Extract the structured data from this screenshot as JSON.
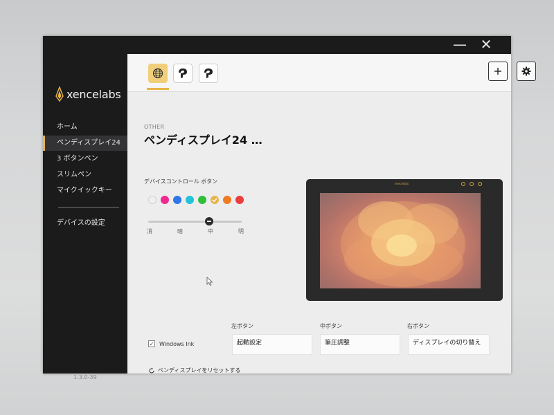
{
  "window": {
    "minimize_glyph": "—",
    "close_glyph": "✕"
  },
  "sidebar": {
    "logo_text": "xencelabs",
    "items": [
      {
        "label": "ホーム"
      },
      {
        "label": "ペンディスプレイ24",
        "active": true
      },
      {
        "label": "3 ボタンペン"
      },
      {
        "label": "スリムペン"
      },
      {
        "label": "マイクイックキー"
      },
      {
        "label": "デバイスの設定"
      }
    ],
    "version": "1.3.0-39"
  },
  "toolbar": {
    "apps": [
      {
        "icon": "globe-icon",
        "active": true
      },
      {
        "icon": "clip-studio-icon"
      },
      {
        "icon": "clip-studio-icon"
      }
    ],
    "add_icon": "plus-icon",
    "settings_icon": "gear-icon"
  },
  "main": {
    "breadcrumb": "OTHER",
    "title": "ペンディスプレイ24 …",
    "device_control": {
      "label": "デバイスコントロール ボタン",
      "colors": [
        "#f0f0f0",
        "#ee2a8f",
        "#2f77e6",
        "#22c4d6",
        "#2fbf3a",
        "#e8b44a",
        "#f07a22",
        "#ea3d3d"
      ],
      "selected_color_index": 5,
      "brightness_labels": [
        "消",
        "暗",
        "中",
        "明"
      ],
      "brightness_selected": "中"
    },
    "tablet": {
      "brand": "xencelabs"
    },
    "buttons": {
      "left": {
        "label": "左ボタン",
        "value": "起動設定"
      },
      "middle": {
        "label": "中ボタン",
        "value": "筆圧調整"
      },
      "right": {
        "label": "右ボタン",
        "value": "ディスプレイの切り替え"
      }
    },
    "windows_ink": {
      "label": "Windows Ink",
      "checked": true
    },
    "reset_label": "ペンディスプレイをリセットする"
  }
}
